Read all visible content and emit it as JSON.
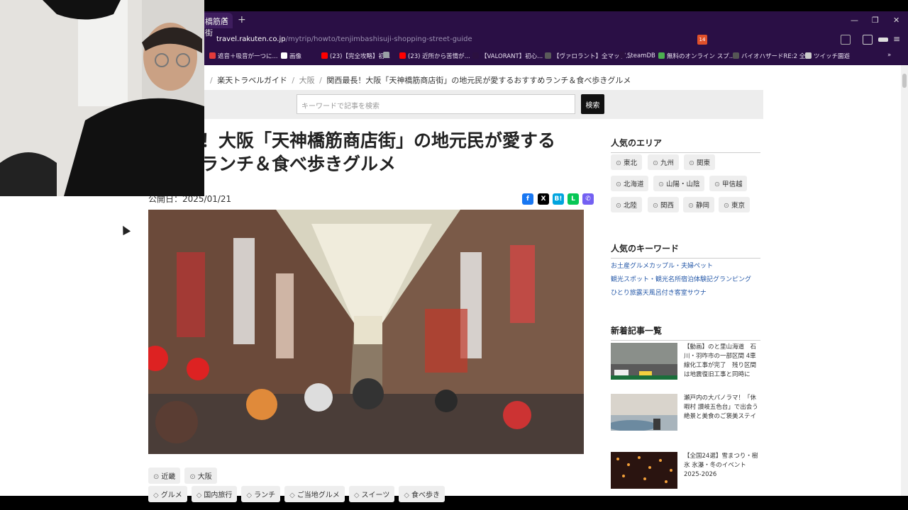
{
  "browser": {
    "tab_title": "橋筋店街",
    "tab_close": "✕",
    "new_tab": "+",
    "url_host": "travel.rakuten.co.jp",
    "url_path": "/mytrip/howto/tenjimbashisuji-shopping-street-guide",
    "window_min": "—",
    "window_max": "❐",
    "window_close": "✕",
    "ext_badge": "14",
    "bookmarks": [
      {
        "label": "遮音＋吸音が一つに...",
        "color": "#e23b3b"
      },
      {
        "label": "画像",
        "color": "#ffffff",
        "x": true
      },
      {
        "label": "(23)【完全攻略】初...",
        "color": "#ff0000"
      },
      {
        "label": "",
        "color": "#9aa0a6"
      },
      {
        "label": "(23) 近所から苦情が...",
        "color": "#ff0000"
      },
      {
        "label": "【VALORANT】初心...",
        "color": "#2b1040"
      },
      {
        "label": "【ヴァロラント】全マップ...",
        "color": "#5a5a5a"
      },
      {
        "label": "SteamDB",
        "color": "#2b1040"
      },
      {
        "label": "無料のオンライン スプ...",
        "color": "#4caf50"
      },
      {
        "label": "バイオハザードRE:2 全...",
        "color": "#555555"
      },
      {
        "label": "ツイッチ園遊",
        "color": "#cccccc"
      }
    ],
    "more": "»"
  },
  "breadcrumb": {
    "home": "楽天トラベルガイド",
    "sep": "/",
    "area": "大阪",
    "current": "関西最長！大阪「天神橋筋商店街」の地元民が愛するおすすめランチ＆食べ歩きグルメ"
  },
  "search": {
    "placeholder": "キーワードで記事を検索",
    "button": "検索"
  },
  "article": {
    "title_line1": "長！大阪「天神橋筋商店街」の地元民が愛する",
    "title_line2": "めランチ＆食べ歩きグルメ",
    "pubdate": "公開日：2025/01/21",
    "region_tags": [
      "近畿",
      "大阪"
    ],
    "topic_tags": [
      "グルメ",
      "国内旅行",
      "ランチ",
      "ご当地グルメ",
      "スイーツ",
      "食べ歩き"
    ],
    "share": [
      {
        "name": "facebook",
        "glyph": "f",
        "color": "#1877f2"
      },
      {
        "name": "x",
        "glyph": "X",
        "color": "#000000"
      },
      {
        "name": "hatena",
        "glyph": "B!",
        "color": "#00a4de"
      },
      {
        "name": "line",
        "glyph": "L",
        "color": "#06c755"
      },
      {
        "name": "viber",
        "glyph": "✆",
        "color": "#7360f2"
      }
    ]
  },
  "sidebar": {
    "popular_areas_title": "人気のエリア",
    "areas": [
      "東北",
      "九州",
      "関東",
      "北海道",
      "山陽・山陰",
      "甲信越",
      "北陸",
      "関西",
      "静岡",
      "東京"
    ],
    "popular_keywords_title": "人気のキーワード",
    "keywords": [
      "お土産グルメカップル・夫婦ペット",
      "観光スポット・観光名所宿泊体験記グランピング",
      "ひとり旅露天風呂付き客室サウナ"
    ],
    "new_articles_title": "新着記事一覧",
    "news": [
      {
        "text": "【動画】のと里山海道　石川・羽咋市の一部区間 4車線化工事が完了　残り区間は地震復旧工事と同時に"
      },
      {
        "text": "瀬戸内の大パノラマ！「休暇村 讃岐五色台」で出会う絶景と美食のご褒美ステイ"
      },
      {
        "text": "【全国24選】雪まつり・樹氷 氷瀑・冬のイベント2025-2026"
      }
    ]
  },
  "colors": {
    "browser_bg": "#2a0f45",
    "page_bg": "#ffffff",
    "link_blue": "#2558a8"
  }
}
